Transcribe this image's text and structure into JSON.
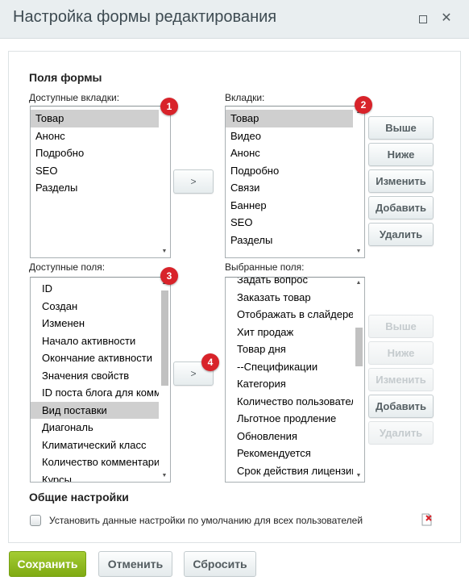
{
  "window": {
    "title": "Настройка формы редактирования",
    "maximize_icon": "maximize-icon",
    "close_icon": "close-icon",
    "close_glyph": "✕"
  },
  "form_fields": {
    "section_title": "Поля формы",
    "available_tabs_label": "Доступные вкладки:",
    "available_tabs": [
      {
        "label": "Товар",
        "selected": true
      },
      {
        "label": "Анонс",
        "selected": false
      },
      {
        "label": "Подробно",
        "selected": false
      },
      {
        "label": "SEO",
        "selected": false
      },
      {
        "label": "Разделы",
        "selected": false
      }
    ],
    "tabs_label": "Вкладки:",
    "tabs": [
      {
        "label": "Товар",
        "selected": true
      },
      {
        "label": "Видео",
        "selected": false
      },
      {
        "label": "Анонс",
        "selected": false
      },
      {
        "label": "Подробно",
        "selected": false
      },
      {
        "label": "Связи",
        "selected": false
      },
      {
        "label": "Баннер",
        "selected": false
      },
      {
        "label": "SEO",
        "selected": false
      },
      {
        "label": "Разделы",
        "selected": false
      }
    ],
    "add_tab_button": ">",
    "tab_buttons": {
      "up": "Выше",
      "down": "Ниже",
      "edit": "Изменить",
      "add": "Добавить",
      "delete": "Удалить"
    },
    "available_fields_label": "Доступные поля:",
    "available_fields": [
      {
        "label": "ID",
        "selected": false
      },
      {
        "label": "Создан",
        "selected": false
      },
      {
        "label": "Изменен",
        "selected": false
      },
      {
        "label": "Начало активности",
        "selected": false
      },
      {
        "label": "Окончание активности",
        "selected": false
      },
      {
        "label": "Значения свойств",
        "selected": false
      },
      {
        "label": "ID поста блога для комментариев",
        "selected": false
      },
      {
        "label": "Вид поставки",
        "selected": true
      },
      {
        "label": "Диагональ",
        "selected": false
      },
      {
        "label": "Климатический класс",
        "selected": false
      },
      {
        "label": "Количество комментариев",
        "selected": false
      },
      {
        "label": "Курсы",
        "selected": false
      }
    ],
    "selected_fields_label": "Выбранные поля:",
    "selected_fields": [
      {
        "label": "Задать вопрос"
      },
      {
        "label": "Заказать товар"
      },
      {
        "label": "Отображать в слайдере"
      },
      {
        "label": "Хит продаж"
      },
      {
        "label": "Товар дня"
      },
      {
        "label": "--Спецификации"
      },
      {
        "label": "Категория"
      },
      {
        "label": "Количество пользователей"
      },
      {
        "label": "Льготное продление"
      },
      {
        "label": "Обновления"
      },
      {
        "label": "Рекомендуется"
      },
      {
        "label": "Срок действия лицензии"
      }
    ],
    "add_field_button": ">",
    "field_buttons": {
      "up": "Выше",
      "down": "Ниже",
      "edit": "Изменить",
      "add": "Добавить",
      "delete": "Удалить"
    },
    "badges": [
      "1",
      "2",
      "3",
      "4"
    ]
  },
  "general_settings": {
    "section_title": "Общие настройки",
    "default_for_all_label": "Установить данные настройки по умолчанию для всех пользователей",
    "default_for_all_checked": false,
    "reset_icon": "delete-settings-icon"
  },
  "footer": {
    "save": "Сохранить",
    "cancel": "Отменить",
    "reset": "Сбросить"
  },
  "colors": {
    "save_green": "#8dba1e",
    "badge_red": "#d8232a",
    "selection_gray": "#cfcfcf"
  }
}
